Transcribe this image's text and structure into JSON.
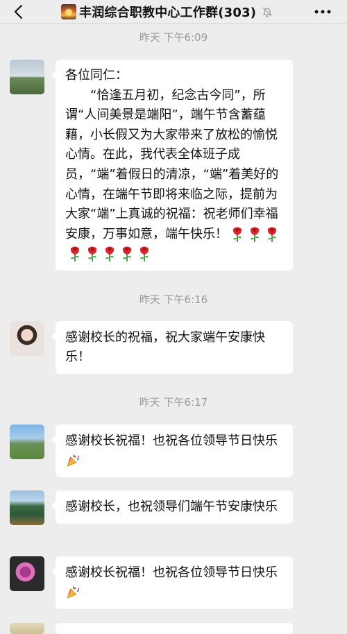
{
  "header": {
    "back_icon": "chevron-left-icon",
    "group_icon": "sunset-icon",
    "title": "丰润综合职教中心工作群(303)",
    "mute_icon": "bell-muted-icon",
    "more_icon": "more-dots-icon"
  },
  "timestamps": {
    "t1": "昨天 下午6:09",
    "t2": "昨天 下午6:16",
    "t3": "昨天 下午6:17"
  },
  "messages": [
    {
      "avatar": "landscape-avatar",
      "lines": {
        "salutation": "各位同仁：",
        "body": "“恰逢五月初，纪念古今同”，所谓“人间美景是端阳”，端午节含蓄蕴藉，小长假又为大家带来了放松的愉悦心情。在此，我代表全体班子成员，“端”着假日的清凉，“端”着美好的心情，在端午节即将来临之际，提前为大家“端”上真诚的祝福：祝老师们幸福安康，万事如意，端午快乐！"
      },
      "emoji": "rose-icon",
      "emoji_count": 8
    },
    {
      "avatar": "woman-portrait-avatar",
      "text": "感谢校长的祝福，祝大家端午安康快乐！"
    },
    {
      "avatar": "mountain-path-avatar",
      "text": "感谢校长祝福！也祝各位领导节日快乐",
      "emoji": "party-popper-icon"
    },
    {
      "avatar": "trees-avatar",
      "text": "感谢校长，也祝领导们端午节安康快乐"
    },
    {
      "avatar": "flower-avatar",
      "text": "感谢校长祝福！也祝各位领导节日快乐",
      "emoji": "party-popper-icon"
    }
  ]
}
